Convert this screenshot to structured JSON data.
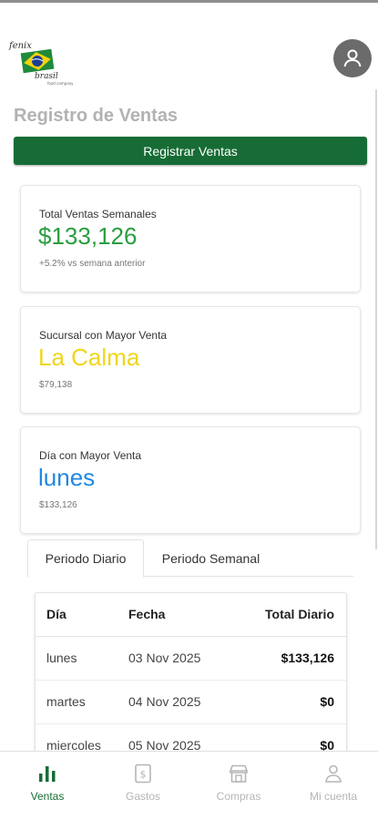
{
  "page": {
    "title": "Registro de Ventas",
    "register_button": "Registrar Ventas"
  },
  "logo": {
    "text_top": "fenix",
    "text_bottom": "brasil",
    "tagline": "food company"
  },
  "colors": {
    "brand_green": "#176c35",
    "total_value": "#2a9d3f",
    "sucursal_value": "#f2d51a",
    "dia_value": "#1e88e5"
  },
  "cards": [
    {
      "label": "Total Ventas Semanales",
      "value": "$133,126",
      "sub": "+5.2% vs semana anterior"
    },
    {
      "label": "Sucursal con Mayor Venta",
      "value": "La Calma",
      "sub": "$79,138"
    },
    {
      "label": "Día con Mayor Venta",
      "value": "lunes",
      "sub": "$133,126"
    }
  ],
  "tabs": [
    {
      "label": "Periodo Diario",
      "active": true
    },
    {
      "label": "Periodo Semanal",
      "active": false
    }
  ],
  "table": {
    "headers": [
      "Día",
      "Fecha",
      "Total Diario"
    ],
    "rows": [
      [
        "lunes",
        "03 Nov 2025",
        "$133,126"
      ],
      [
        "martes",
        "04 Nov 2025",
        "$0"
      ],
      [
        "miercoles",
        "05 Nov 2025",
        "$0"
      ]
    ]
  },
  "nav": [
    {
      "label": "Ventas",
      "icon": "bar-chart-icon",
      "active": true
    },
    {
      "label": "Gastos",
      "icon": "receipt-dollar-icon",
      "active": false
    },
    {
      "label": "Compras",
      "icon": "storefront-icon",
      "active": false
    },
    {
      "label": "Mi cuenta",
      "icon": "user-icon",
      "active": false
    }
  ],
  "avatar_icon": "user-avatar-icon"
}
